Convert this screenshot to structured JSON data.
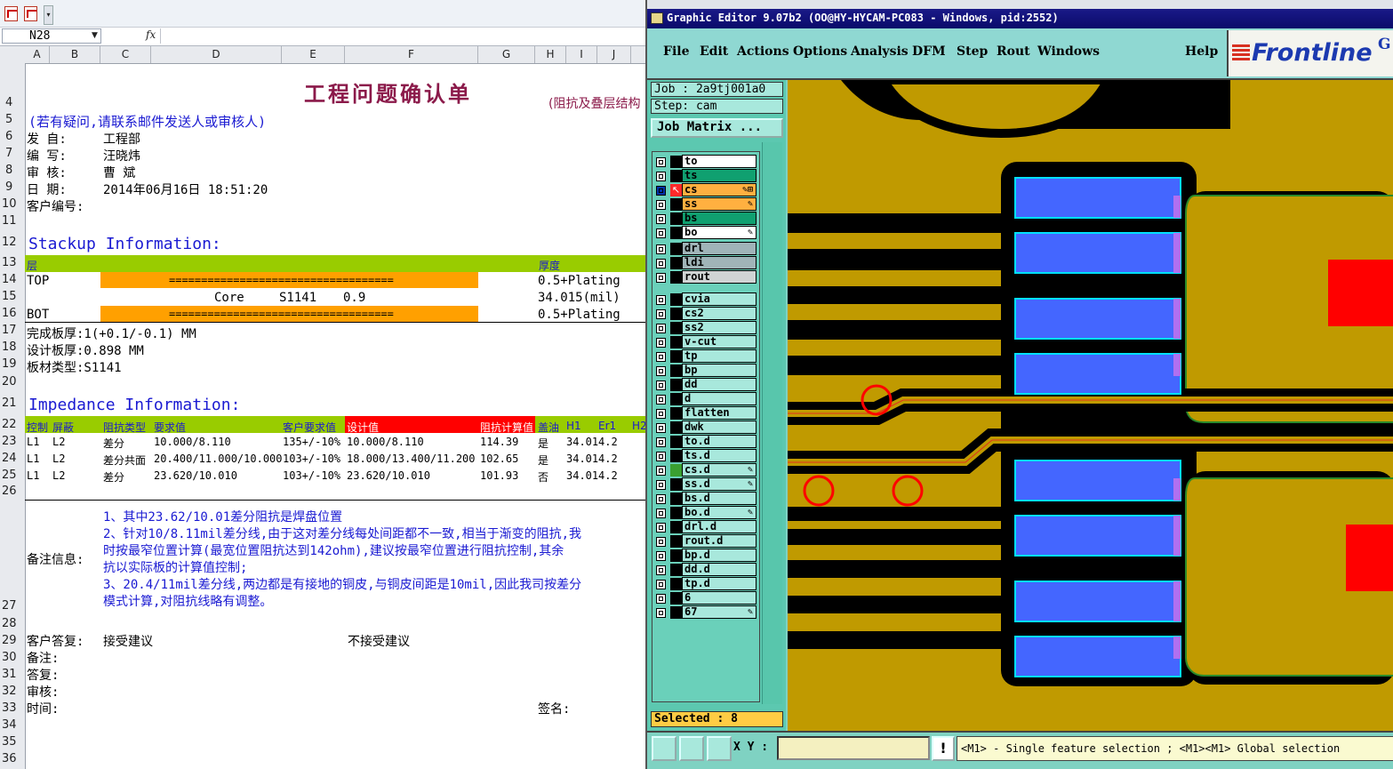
{
  "excel": {
    "name_box": "N28",
    "fx": "fx",
    "columns": [
      "A",
      "B",
      "C",
      "D",
      "E",
      "F",
      "G",
      "H",
      "I",
      "J"
    ],
    "rows": [
      "4",
      "5",
      "6",
      "7",
      "8",
      "9",
      "10",
      "11",
      "12",
      "13",
      "14",
      "15",
      "16",
      "17",
      "18",
      "19",
      "20",
      "21",
      "22",
      "23",
      "24",
      "25",
      "26",
      "27",
      "28",
      "29",
      "30",
      "31",
      "32",
      "33",
      "34",
      "35",
      "36"
    ],
    "title": "工程问题确认单",
    "subtitle": "(阻抗及叠层结构",
    "contact_note": "(若有疑问,请联系邮件发送人或审核人)",
    "from_label": "发    自:",
    "from_value": "工程部",
    "author_label": "编    写:",
    "author_value": "汪晓炜",
    "reviewer_label": "审    核:",
    "reviewer_value": "曹  斌",
    "date_label": "日    期:",
    "date_value": "2014年06月16日 18:51:20",
    "customer_no_label": "客户编号:",
    "stackup_title": "Stackup Information:",
    "stackup_header_layer": "层",
    "stackup_header_thickness": "厚度",
    "stackup_rows": [
      {
        "layer": "TOP",
        "bar": "===================================",
        "thickness": "0.5+Plating"
      },
      {
        "layer": "",
        "core": "Core",
        "material": "S1141",
        "value": "0.9",
        "thickness": "34.015(mil)"
      },
      {
        "layer": "BOT",
        "bar": "===================================",
        "thickness": "0.5+Plating"
      }
    ],
    "finish_thickness": "完成板厚:1(+0.1/-0.1) MM",
    "design_thickness": "设计板厚:0.898 MM",
    "board_type": "板材类型:S1141",
    "impedance_title": "Impedance Information:",
    "imp_headers": [
      "控制",
      "屏蔽",
      "阻抗类型",
      "要求值",
      "客户要求值",
      "设计值",
      "阻抗计算值",
      "盖油",
      "H1",
      "Er1",
      "H2"
    ],
    "imp_rows": [
      [
        "L1",
        "L2",
        "差分",
        "10.000/8.110",
        "135+/-10%",
        "10.000/8.110",
        "114.39",
        "是",
        "34.01",
        "4.2"
      ],
      [
        "L1",
        "L2",
        "差分共面",
        "20.400/11.000/10.000",
        "103+/-10%",
        "18.000/13.400/11.200",
        "102.65",
        "是",
        "34.01",
        "4.2"
      ],
      [
        "L1",
        "L2",
        "差分",
        "23.620/10.010",
        "103+/-10%",
        "23.620/10.010",
        "101.93",
        "否",
        "34.01",
        "4.2"
      ]
    ],
    "remark_label": "备注信息:",
    "remarks": [
      "1、其中23.62/10.01差分阻抗是焊盘位置",
      "2、针对10/8.11mil差分线,由于这对差分线每处间距都不一致,相当于渐变的阻抗,我",
      "时按最窄位置计算(最宽位置阻抗达到142ohm),建议按最窄位置进行阻抗控制,其余",
      "抗以实际板的计算值控制;",
      "3、20.4/11mil差分线,两边都是有接地的铜皮,与铜皮间距是10mil,因此我司按差分",
      "模式计算,对阻抗线略有调整。"
    ],
    "reply_label": "客户答复:",
    "accept": "接受建议",
    "reject": "不接受建议",
    "remark2": "备注:",
    "answer": "答复:",
    "review": "审核:",
    "time": "时间:",
    "sign": "签名:"
  },
  "ge": {
    "title": "Graphic Editor 9.07b2 (OO@HY-HYCAM-PC083 - Windows, pid:2552)",
    "menus": [
      "File",
      "Edit",
      "Actions",
      "Options",
      "Analysis",
      "DFM",
      "Step",
      "Rout",
      "Windows",
      "Help"
    ],
    "logo": "Frontline",
    "logo_tail": "G",
    "job": "Job : 2a9tj001a0",
    "step": "Step: cam",
    "job_matrix": "Job Matrix ...",
    "layers": [
      {
        "name": "to",
        "color": "#ffffff",
        "flag": ""
      },
      {
        "name": "ts",
        "color": "#10a070",
        "flag": ""
      },
      {
        "name": "cs",
        "color": "#ffb040",
        "flag": "✎⊞",
        "active": true
      },
      {
        "name": "ss",
        "color": "#ffb040",
        "flag": "✎"
      },
      {
        "name": "bs",
        "color": "#10a070",
        "flag": ""
      },
      {
        "name": "bo",
        "color": "#ffffff",
        "flag": "✎"
      },
      {
        "name": "drl",
        "color": "#a0b4b8",
        "flag": ""
      },
      {
        "name": "ldi",
        "color": "#a0b4b8",
        "flag": ""
      },
      {
        "name": "rout",
        "color": "#d0d4d4",
        "flag": ""
      },
      {
        "name": "cvia",
        "color": "#a8e8dc",
        "flag": ""
      },
      {
        "name": "cs2",
        "color": "#a8e8dc",
        "flag": ""
      },
      {
        "name": "ss2",
        "color": "#a8e8dc",
        "flag": ""
      },
      {
        "name": "v-cut",
        "color": "#a8e8dc",
        "flag": ""
      },
      {
        "name": "tp",
        "color": "#a8e8dc",
        "flag": ""
      },
      {
        "name": "bp",
        "color": "#a8e8dc",
        "flag": ""
      },
      {
        "name": "dd",
        "color": "#a8e8dc",
        "flag": ""
      },
      {
        "name": "d",
        "color": "#a8e8dc",
        "flag": ""
      },
      {
        "name": "flatten",
        "color": "#a8e8dc",
        "flag": ""
      },
      {
        "name": "dwk",
        "color": "#a8e8dc",
        "flag": ""
      },
      {
        "name": "to.d",
        "color": "#a8e8dc",
        "flag": ""
      },
      {
        "name": "ts.d",
        "color": "#a8e8dc",
        "flag": ""
      },
      {
        "name": "cs.d",
        "color": "#a8e8dc",
        "flag": "✎",
        "greenmark": true
      },
      {
        "name": "ss.d",
        "color": "#a8e8dc",
        "flag": "✎"
      },
      {
        "name": "bs.d",
        "color": "#a8e8dc",
        "flag": ""
      },
      {
        "name": "bo.d",
        "color": "#a8e8dc",
        "flag": "✎"
      },
      {
        "name": "drl.d",
        "color": "#a8e8dc",
        "flag": ""
      },
      {
        "name": "rout.d",
        "color": "#a8e8dc",
        "flag": ""
      },
      {
        "name": "bp.d",
        "color": "#a8e8dc",
        "flag": ""
      },
      {
        "name": "dd.d",
        "color": "#a8e8dc",
        "flag": ""
      },
      {
        "name": "tp.d",
        "color": "#a8e8dc",
        "flag": ""
      },
      {
        "name": "6",
        "color": "#a8e8dc",
        "flag": ""
      },
      {
        "name": "67",
        "color": "#a8e8dc",
        "flag": "✎"
      }
    ],
    "selected": "Selected : 8",
    "xy_label": "X Y :",
    "xy_value": "",
    "hint": "<M1> - Single feature selection ; <M1><M1> Global selection"
  }
}
